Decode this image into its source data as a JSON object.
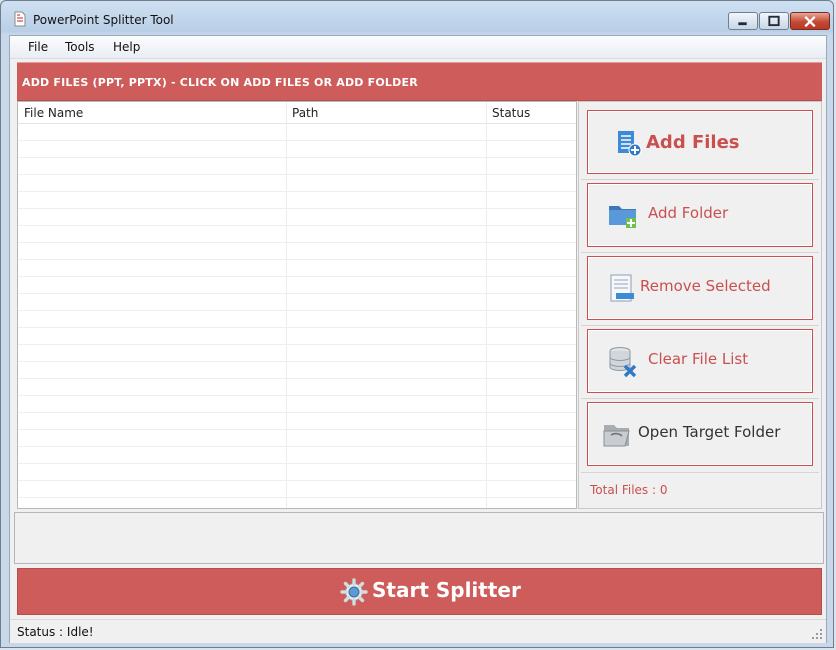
{
  "window": {
    "title": "PowerPoint Splitter Tool",
    "icon": "app-document-icon"
  },
  "menu": [
    "File",
    "Tools",
    "Help"
  ],
  "banner": {
    "text": "ADD FILES (PPT, PPTX) - CLICK ON ADD FILES OR ADD FOLDER"
  },
  "filelist": {
    "columns": [
      "File Name",
      "Path",
      "Status"
    ],
    "rows": []
  },
  "actions": [
    {
      "label": "Add Files",
      "icon": "add-files-icon"
    },
    {
      "label": "Add Folder",
      "icon": "add-folder-icon"
    },
    {
      "label": "Remove Selected",
      "icon": "remove-selected-icon"
    },
    {
      "label": "Clear File List",
      "icon": "clear-list-icon"
    },
    {
      "label": "Open Target Folder",
      "icon": "open-folder-icon"
    }
  ],
  "total_files": "Total Files : 0",
  "start_button": {
    "label": "Start Splitter",
    "icon": "gear-icon"
  },
  "status": "Status  :  Idle!",
  "colors": {
    "accent": "#cd5c5a",
    "accent_text": "#c9504f"
  }
}
